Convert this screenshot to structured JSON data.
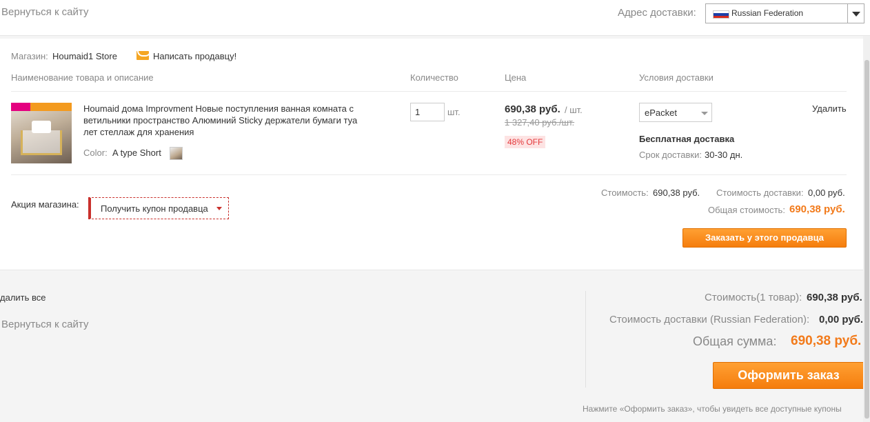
{
  "header": {
    "back_link": "Вернуться к сайту",
    "address_label": "Адрес доставки:",
    "country": "Russian Federation"
  },
  "store": {
    "name_label": "Магазин:",
    "name": "Houmaid1 Store",
    "contact_label": "Написать продавцу!",
    "columns": {
      "product": "Наименование товара и описание",
      "quantity": "Количество",
      "price": "Цена",
      "shipping": "Условия доставки"
    },
    "item": {
      "title": "Houmaid дома Improvment Новые поступления ванная комната с ветильники пространство Алюминий Sticky держатели бумаги туа лет стеллаж для хранения",
      "color_label": "Color:",
      "color_value": "A type Short",
      "quantity": "1",
      "quantity_unit": "шт.",
      "price": "690,38 руб.",
      "price_per": "/ шт.",
      "old_price": "1 327,40 руб./шт.",
      "discount": "48% OFF",
      "shipping_method": "ePacket",
      "free_shipping": "Бесплатная доставка",
      "delivery_time_label": "Срок доставки:",
      "delivery_time": "30-30 дн.",
      "delete_label": "Удалить"
    },
    "promo_label": "Акция магазина:",
    "coupon_label": "Получить купон продавца",
    "summary": {
      "cost_label": "Стоимость:",
      "cost": "690,38 руб.",
      "shipping_label": "Стоимость доставки:",
      "shipping": "0,00 руб.",
      "total_label": "Общая стоимость:",
      "total": "690,38 руб."
    },
    "order_button": "Заказать у этого продавца"
  },
  "footer": {
    "delete_all": "далить все",
    "back_link": "Вернуться к сайту",
    "cost_label": "Стоимость(1 товар):",
    "cost": "690,38 руб.",
    "shipping_label": "Стоимость доставки (Russian Federation):",
    "shipping": "0,00 руб.",
    "total_label": "Общая сумма:",
    "total": "690,38 руб.",
    "checkout_button": "Оформить заказ",
    "hint": "Нажмите «Оформить заказ», чтобы увидеть все доступные купоны"
  },
  "colors": {
    "accent_orange": "#f57d0d",
    "price_orange": "#f27a1a",
    "coupon_red": "#c9302c",
    "discount_red": "#e4393c"
  },
  "icons": {
    "flag": "russia-flag-icon",
    "mail": "envelope-icon",
    "dropdown": "chevron-down-icon"
  }
}
